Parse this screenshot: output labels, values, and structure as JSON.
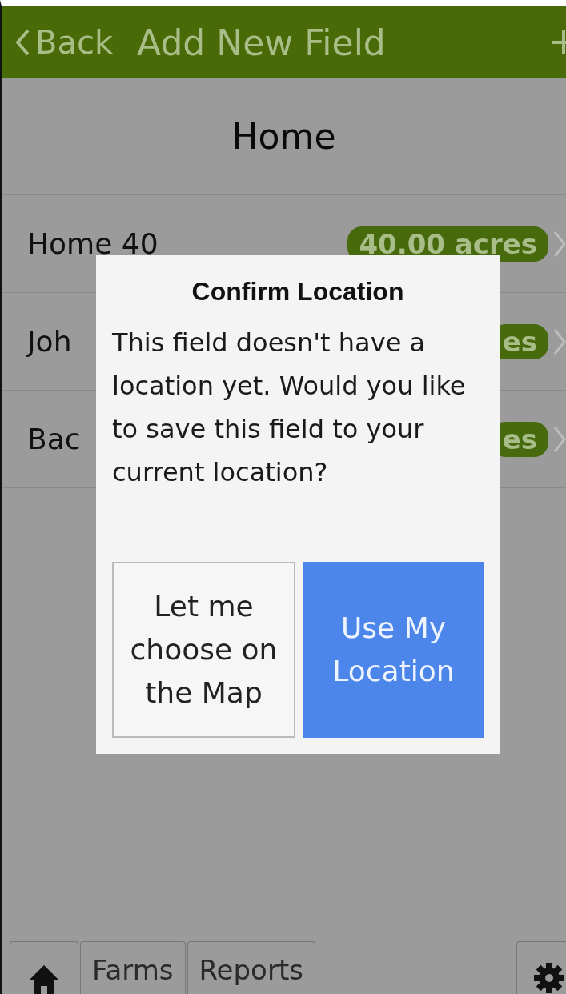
{
  "header": {
    "back_label": "Back",
    "title": "Add New Field"
  },
  "section_title": "Home",
  "fields": [
    {
      "name": "Home 40",
      "acreage": "40.00 acres"
    },
    {
      "name": "Joh",
      "acreage": "es"
    },
    {
      "name": "Bac",
      "acreage": "es"
    }
  ],
  "dialog": {
    "title": "Confirm Location",
    "message": "This field doesn't have a location yet. Would you like to save this field to your current location?",
    "buttons": [
      {
        "label": "Let me choose on the Map",
        "kind": "secondary"
      },
      {
        "label": "Use My Location",
        "kind": "primary"
      }
    ]
  },
  "tab_bar": {
    "tabs": [
      {
        "label": "Farms"
      },
      {
        "label": "Reports"
      }
    ]
  }
}
